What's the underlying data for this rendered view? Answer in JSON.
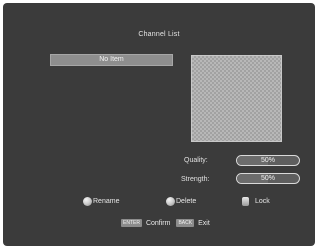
{
  "window": {
    "title": "Channel List"
  },
  "channel_list": {
    "items": [
      "No Item"
    ]
  },
  "signal": {
    "quality_label": "Quality:",
    "quality_value": "50%",
    "quality_level": 0.5,
    "strength_label": "Strength:",
    "strength_value": "50%",
    "strength_level": 0.5
  },
  "actions": {
    "rename": {
      "label": "Rename",
      "icon": "rename-icon"
    },
    "delete": {
      "label": "Delete",
      "icon": "delete-icon"
    },
    "lock": {
      "label": "Lock",
      "icon": "lock-icon"
    }
  },
  "hints": {
    "confirm_key": "ENTER",
    "confirm_label": "Confirm",
    "exit_key": "BACK",
    "exit_label": "Exit"
  },
  "colors": {
    "background": "#3b3b3b",
    "list_highlight": "#8e8e8e",
    "text": "#e6e6e6"
  }
}
